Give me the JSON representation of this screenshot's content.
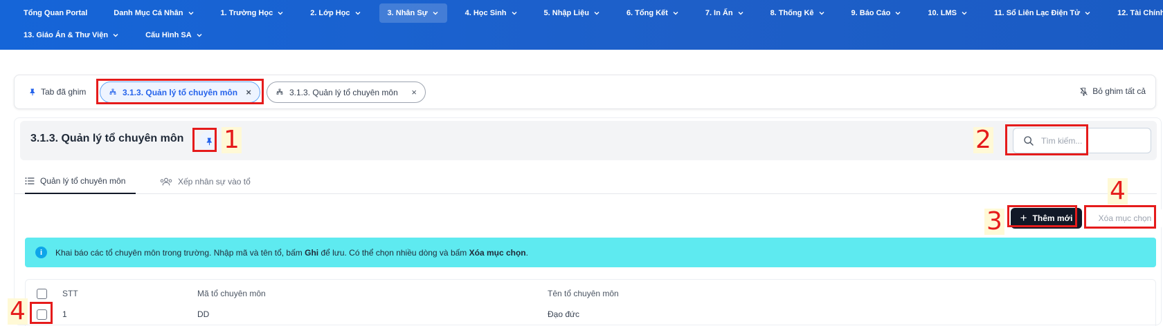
{
  "nav": {
    "row1": [
      {
        "label": "Tổng Quan Portal",
        "chevron": false,
        "active": false
      },
      {
        "label": "Danh Mục Cá Nhân",
        "chevron": true,
        "active": false
      },
      {
        "label": "1. Trường Học",
        "chevron": true,
        "active": false
      },
      {
        "label": "2. Lớp Học",
        "chevron": true,
        "active": false
      },
      {
        "label": "3. Nhân Sự",
        "chevron": true,
        "active": true
      },
      {
        "label": "4. Học Sinh",
        "chevron": true,
        "active": false
      },
      {
        "label": "5. Nhập Liệu",
        "chevron": true,
        "active": false
      },
      {
        "label": "6. Tổng Kết",
        "chevron": true,
        "active": false
      },
      {
        "label": "7. In Ấn",
        "chevron": true,
        "active": false
      },
      {
        "label": "8. Thống Kê",
        "chevron": true,
        "active": false
      },
      {
        "label": "9. Báo Cáo",
        "chevron": true,
        "active": false
      },
      {
        "label": "10. LMS",
        "chevron": true,
        "active": false
      },
      {
        "label": "11. Sổ Liên Lạc Điện Tử",
        "chevron": true,
        "active": false
      },
      {
        "label": "12. Tài Chính",
        "chevron": true,
        "active": false
      }
    ],
    "row2": [
      {
        "label": "13. Giáo Án & Thư Viện",
        "chevron": true,
        "active": false
      },
      {
        "label": "Cấu Hình SA",
        "chevron": true,
        "active": false
      }
    ]
  },
  "pinbar": {
    "label": "Tab đã ghim",
    "tabs": [
      {
        "label": "3.1.3. Quản lý tổ chuyên môn",
        "close": "×",
        "active": true
      },
      {
        "label": "3.1.3. Quản lý tổ chuyên môn",
        "close": "×",
        "active": false
      }
    ],
    "unpin_all": "Bỏ ghim tất cả"
  },
  "page": {
    "title": "3.1.3. Quản lý tổ chuyên môn",
    "search_placeholder": "Tìm kiếm..."
  },
  "tabs": [
    {
      "label": "Quản lý tổ chuyên môn",
      "icon": "list-icon",
      "active": true
    },
    {
      "label": "Xếp nhân sự vào tổ",
      "icon": "users-icon",
      "active": false
    }
  ],
  "actions": {
    "add_label": "Thêm mới",
    "add_plus": "+",
    "delete_label": "Xóa mục chọn"
  },
  "info": {
    "icon": "i",
    "text_1": "Khai báo các tổ chuyên môn trong trường. Nhập mã và tên tổ, bấm ",
    "bold_1": "Ghi",
    "text_2": " để lưu. Có thể chọn nhiều dòng và bấm ",
    "bold_2": "Xóa mục chọn",
    "text_3": "."
  },
  "table": {
    "columns": [
      "STT",
      "Mã tổ chuyên môn",
      "Tên tổ chuyên môn"
    ],
    "rows": [
      {
        "stt": "1",
        "code": "DD",
        "name": "Đạo đức"
      }
    ]
  },
  "annotations": {
    "n1": "1",
    "n2": "2",
    "n3": "3",
    "n4a": "4",
    "n4b": "4"
  },
  "colors": {
    "nav_bg": "#1565d8",
    "accent": "#2563eb",
    "annotation": "#e51b1b",
    "info_bg": "#5eeaf0",
    "primary_button": "#111827"
  }
}
